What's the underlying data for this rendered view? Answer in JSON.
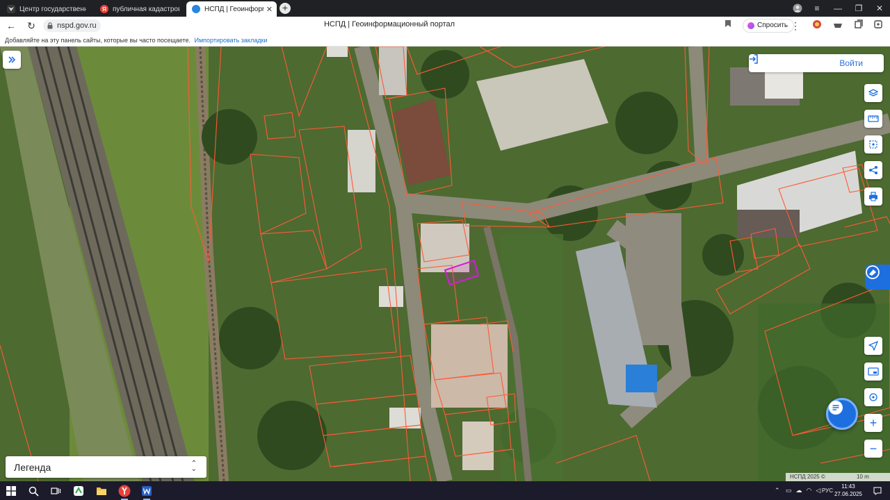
{
  "browser": {
    "tabs": [
      {
        "label": "Центр государственной к",
        "icon": "eagle-icon"
      },
      {
        "label": "публичная кадастровая к",
        "icon": "yandex-icon"
      },
      {
        "label": "НСПД | Геоинформаци",
        "icon": "globe-icon",
        "active": true
      }
    ],
    "new_tab": "+",
    "window_controls": {
      "minimize": "—",
      "maximize": "❐",
      "close": "✕"
    },
    "url": "nspd.gov.ru",
    "page_title": "НСПД | Геоинформационный портал",
    "ask_button": "Спросить",
    "bookmarks_hint": "Добавляйте на эту панель сайты, которые вы часто посещаете.",
    "bookmarks_import": "Импортировать закладки"
  },
  "map": {
    "login_label": "Войти",
    "legend_label": "Легенда",
    "attribution": "НСПД 2025 ©",
    "scale_label": "10 m",
    "controls": [
      "layers-icon",
      "ruler-icon",
      "select-area-icon",
      "share-icon",
      "print-icon",
      "locate-icon",
      "minimap-icon",
      "search-place-icon",
      "zoom-in-icon",
      "zoom-out-icon"
    ],
    "zoom_in": "+",
    "zoom_out": "−",
    "colors": {
      "parcel_border": "#ff5a36",
      "selected_parcel": "#d21dd6",
      "accent": "#1d6fe0"
    }
  },
  "taskbar": {
    "apps": [
      "windows-start-icon",
      "search-icon",
      "task-view-icon",
      "green-app-icon",
      "file-explorer-icon",
      "yandex-browser-icon",
      "word-icon"
    ],
    "language": "РУС",
    "time": "11:43",
    "date": "27.06.2025"
  }
}
